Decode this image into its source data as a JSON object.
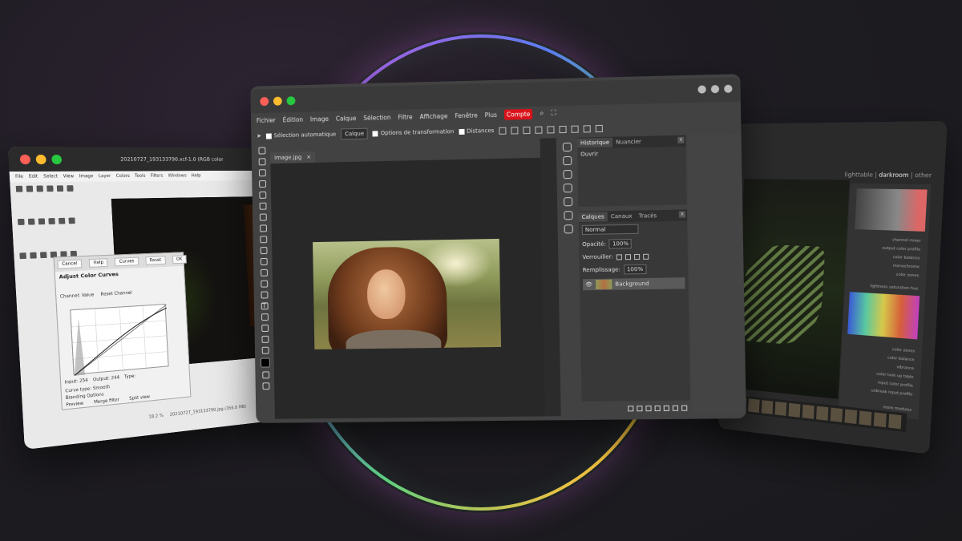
{
  "gimp": {
    "title": "20210727_193133790.xcf-1.0 (RGB color",
    "menu": [
      "File",
      "Edit",
      "Select",
      "View",
      "Image",
      "Layer",
      "Colors",
      "Tools",
      "Filters",
      "Windows",
      "Help"
    ],
    "dialog": {
      "buttons": [
        "Cancel",
        "Help",
        "Curves",
        "Reset",
        "OK"
      ],
      "title": "Adjust Color Curves",
      "channel_label": "Channel:",
      "channel_value": "Value",
      "reset_channel": "Reset Channel",
      "input_label": "Input:",
      "input_value": "254",
      "output_label": "Output:",
      "output_value": "244",
      "type_label": "Type:",
      "curve_type_label": "Curve type:",
      "curve_type_value": "Smooth",
      "blending": "Blending Options",
      "preview": "Preview",
      "merge_filter": "Merge filter",
      "split_view": "Split view"
    },
    "zoom": "18.2 %",
    "status": "20210727_193133790.jpg (356.8 MB)"
  },
  "photopea": {
    "menu": [
      "Fichier",
      "Édition",
      "Image",
      "Calque",
      "Sélection",
      "Filtre",
      "Affichage",
      "Fenêtre",
      "Plus"
    ],
    "compte": "Compte",
    "auto_select": "Sélection automatique",
    "layer_select": "Calque",
    "transform_options": "Options de transformation",
    "distances": "Distances",
    "doc_tab": "image.jpg",
    "doc_close": "×",
    "panel_top": {
      "tabs": [
        "Historique",
        "Nuancier"
      ],
      "items": [
        "Ouvrir"
      ]
    },
    "panel_layers": {
      "tabs": [
        "Calques",
        "Canaux",
        "Tracés"
      ],
      "blend_mode": "Normal",
      "opacity_label": "Opacité:",
      "opacity_value": "100%",
      "lock_label": "Verrouiller:",
      "fill_label": "Remplissage:",
      "fill_value": "100%",
      "layer_name": "Background"
    },
    "close_glyph": "x",
    "text_tool_glyph": "T",
    "paragraph_glyph": "¶"
  },
  "darktable": {
    "modes": [
      "lighttable",
      "darkroom",
      "other"
    ],
    "modules": [
      "channel mixer",
      "output color profile",
      "color balance",
      "monochrome",
      "color zones",
      "color zones",
      "color balance",
      "vibrance",
      "color look up table",
      "input color profile",
      "unbreak input profile"
    ],
    "more_modules": "more modules",
    "tabs_colorzones": [
      "lightness",
      "saturation",
      "hue"
    ]
  },
  "colors": {
    "ring_start": "#f3a83a",
    "ring_end": "#d04fd8",
    "accent_red": "#d9121a"
  }
}
